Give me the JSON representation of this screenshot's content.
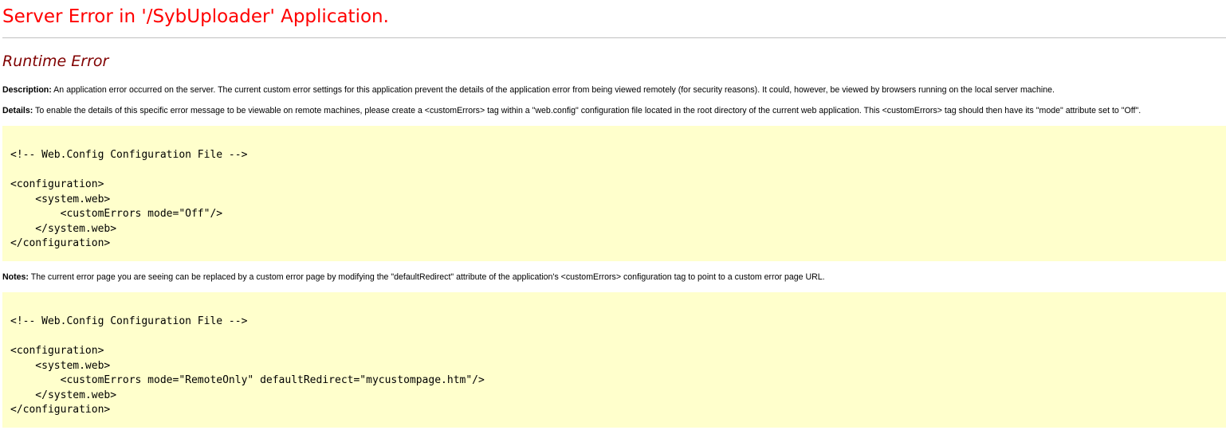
{
  "page_title": "Server Error in '/SybUploader' Application.",
  "error_type": "Runtime Error",
  "description": {
    "label": "Description:",
    "text": " An application error occurred on the server. The current custom error settings for this application prevent the details of the application error from being viewed remotely (for security reasons). It could, however, be viewed by browsers running on the local server machine."
  },
  "details": {
    "label": "Details:",
    "text": " To enable the details of this specific error message to be viewable on remote machines, please create a <customErrors> tag within a \"web.config\" configuration file located in the root directory of the current web application. This <customErrors> tag should then have its \"mode\" attribute set to \"Off\"."
  },
  "code_sample_1": "<!-- Web.Config Configuration File -->\n\n<configuration>\n    <system.web>\n        <customErrors mode=\"Off\"/>\n    </system.web>\n</configuration>",
  "notes": {
    "label": "Notes:",
    "text": " The current error page you are seeing can be replaced by a custom error page by modifying the \"defaultRedirect\" attribute of the application's <customErrors> configuration tag to point to a custom error page URL."
  },
  "code_sample_2": "<!-- Web.Config Configuration File -->\n\n<configuration>\n    <system.web>\n        <customErrors mode=\"RemoteOnly\" defaultRedirect=\"mycustompage.htm\"/>\n    </system.web>\n</configuration>",
  "colors": {
    "title": "#ff0000",
    "subtitle": "#800000",
    "code_background": "#ffffcc",
    "divider": "#c0c0c0"
  }
}
